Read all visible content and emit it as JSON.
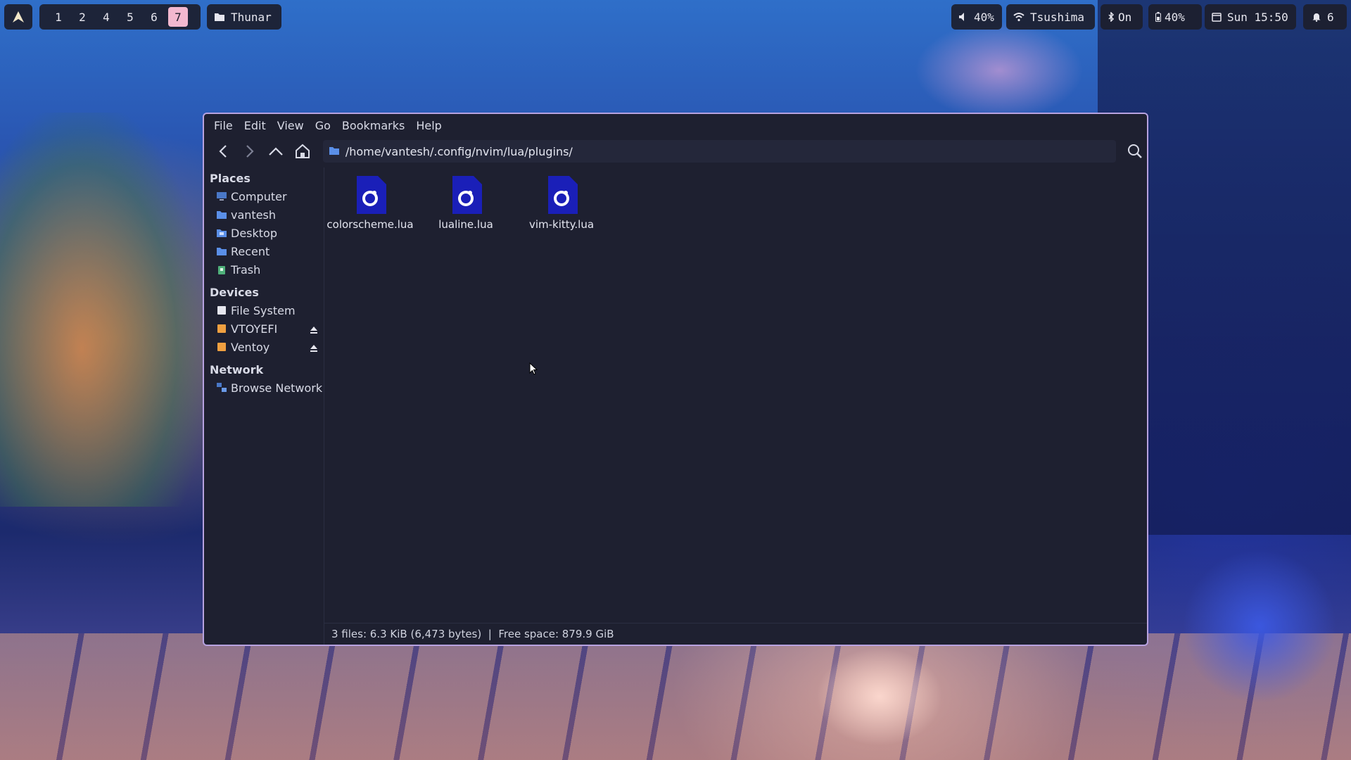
{
  "topbar": {
    "workspaces": [
      "1",
      "2",
      "4",
      "5",
      "6",
      "7"
    ],
    "active_workspace": "7",
    "app_title": "Thunar",
    "volume": "40%",
    "wifi": "Tsushima",
    "bluetooth": "On",
    "battery": "40%",
    "clock": "Sun 15:50",
    "notifications": "6"
  },
  "window": {
    "menu": [
      "File",
      "Edit",
      "View",
      "Go",
      "Bookmarks",
      "Help"
    ],
    "path": "/home/vantesh/.config/nvim/lua/plugins/",
    "sidebar": {
      "places_heading": "Places",
      "places": [
        "Computer",
        "vantesh",
        "Desktop",
        "Recent",
        "Trash"
      ],
      "devices_heading": "Devices",
      "devices": [
        "File System",
        "VTOYEFI",
        "Ventoy"
      ],
      "network_heading": "Network",
      "network": [
        "Browse Network"
      ]
    },
    "files": [
      "colorscheme.lua",
      "lualine.lua",
      "vim-kitty.lua"
    ],
    "status": "3 files: 6.3 KiB (6,473 bytes)  |  Free space: 879.9 GiB"
  },
  "colors": {
    "accent_border": "#b7a2e0",
    "active_workspace": "#f2b8cf",
    "lua_icon": "#1a1fb8",
    "window_bg": "#1e2030"
  }
}
